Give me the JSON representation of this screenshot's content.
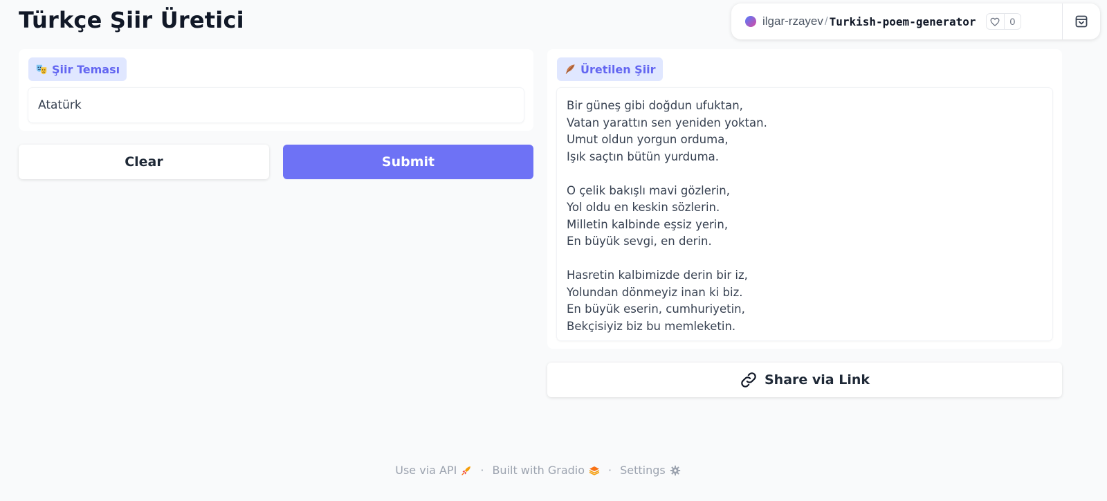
{
  "page": {
    "title": "Türkçe Şiir Üretici"
  },
  "hf_header": {
    "owner": "ilgar-rzayev",
    "separator": "/",
    "repo": "Turkish-poem-generator",
    "like_count": "0",
    "icons": {
      "like": "heart-icon",
      "collapse": "collapse-icon"
    }
  },
  "input_panel": {
    "label": "Şiir Teması",
    "label_icon": "theater-masks-icon",
    "value": "Atatürk"
  },
  "buttons": {
    "clear": "Clear",
    "submit": "Submit",
    "share": "Share via Link"
  },
  "output_panel": {
    "label": "Üretilen Şiir",
    "label_icon": "feather-icon",
    "poem": "Bir güneş gibi doğdun ufuktan,\nVatan yarattın sen yeniden yoktan.\nUmut oldun yorgun orduma,\nIşık saçtın bütün yurduma.\n\nO çelik bakışlı mavi gözlerin,\nYol oldu en keskin sözlerin.\nMilletin kalbinde eşsiz yerin,\nEn büyük sevgi, en derin.\n\nHasretin kalbimizde derin bir iz,\nYolundan dönmeyiz inan ki biz.\nEn büyük eserin, cumhuriyetin,\nBekçisiyiz biz bu memleketin."
  },
  "footer": {
    "api": "Use via API",
    "built": "Built with Gradio",
    "settings": "Settings",
    "separator": "·"
  },
  "colors": {
    "accent": "#6e72f5",
    "chip_bg": "#e0e7ff",
    "chip_text": "#6366f1",
    "background": "#f9fafb"
  }
}
